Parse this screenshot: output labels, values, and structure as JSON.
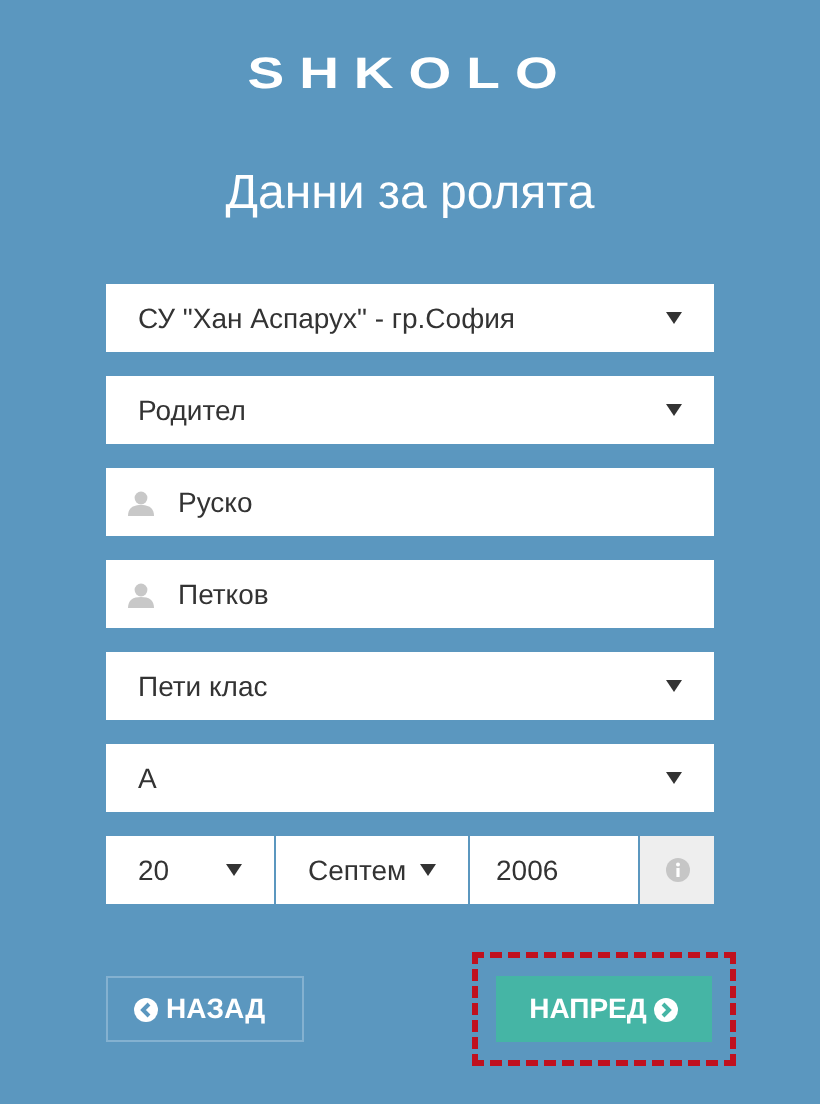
{
  "logo": "SHKOLO",
  "title": "Данни за ролята",
  "fields": [
    {
      "kind": "select",
      "value": "СУ \"Хан Аспарух\" - гр.София"
    },
    {
      "kind": "select",
      "value": "Родител"
    },
    {
      "kind": "person",
      "value": "Руско"
    },
    {
      "kind": "person",
      "value": "Петков"
    },
    {
      "kind": "select",
      "value": "Пети клас"
    },
    {
      "kind": "select",
      "value": "А"
    }
  ],
  "birthdate": {
    "day": "20",
    "month": "Септем",
    "year": "2006"
  },
  "buttons": [
    {
      "kind": "back",
      "label": "НАЗАД",
      "highlighted": false
    },
    {
      "kind": "next",
      "label": "НАПРЕД",
      "highlighted": true
    }
  ]
}
